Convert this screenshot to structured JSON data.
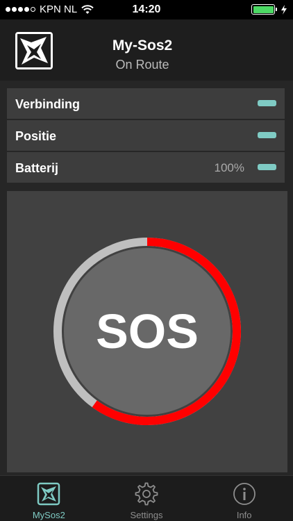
{
  "status_bar": {
    "carrier": "KPN NL",
    "time": "14:20"
  },
  "header": {
    "title": "My-Sos2",
    "subtitle": "On Route"
  },
  "status_rows": [
    {
      "label": "Verbinding",
      "value": "",
      "indicator_color": "#7fcbc4"
    },
    {
      "label": "Positie",
      "value": "",
      "indicator_color": "#7fcbc4"
    },
    {
      "label": "Batterij",
      "value": "100%",
      "indicator_color": "#7fcbc4"
    }
  ],
  "sos": {
    "label": "SOS",
    "progress": 0.6,
    "progress_color": "#ff0000",
    "track_color": "#bfbfbf"
  },
  "tabs": [
    {
      "label": "MySos2",
      "icon": "mysos2-logo-icon",
      "active": true
    },
    {
      "label": "Settings",
      "icon": "gear-icon",
      "active": false
    },
    {
      "label": "Info",
      "icon": "info-icon",
      "active": false
    }
  ],
  "colors": {
    "accent": "#7fcbc4",
    "sos_red": "#ff0000"
  }
}
